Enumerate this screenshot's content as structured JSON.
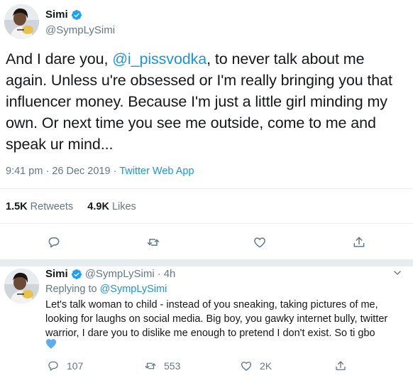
{
  "main_tweet": {
    "name": "Simi",
    "handle": "@SympLySimi",
    "text_before": "And I dare you, ",
    "mention": "@i_pissvodka",
    "text_after": ", to never talk about me again. Unless u're obsessed or I'm really bringing you that influencer money. Because I'm just a little girl minding my own. Or next time you see me outside, come to me and speak ur mind...",
    "time": "9:41 pm",
    "date": "26 Dec 2019",
    "separator": "·",
    "source": "Twitter Web App",
    "retweets_count": "1.5K",
    "retweets_label": "Retweets",
    "likes_count": "4.9K",
    "likes_label": "Likes"
  },
  "reply_tweet": {
    "name": "Simi",
    "handle": "@SympLySimi",
    "separator": "·",
    "age": "4h",
    "replying_label": "Replying to",
    "replying_to": "@SympLySimi",
    "text": "Let's talk woman to child - instead of you sneaking, taking pictures of me, looking for laughs on social media. Big boy, you gawky internet bully, twitter warrior, I dare you to dislike me enough to pretend I don't exist. So ti gbo",
    "emoji": "💙",
    "reply_count": "107",
    "retweet_count": "553",
    "like_count": "2K"
  },
  "colors": {
    "accent": "#1b95e0",
    "verified": "#1da1f2",
    "muted": "#657786",
    "divider": "#e6ecf0"
  },
  "icons": {
    "verified": "verified-badge-icon",
    "reply": "comment-bubble-icon",
    "retweet": "retweet-arrows-icon",
    "like": "heart-outline-icon",
    "share": "share-upload-icon",
    "more": "chevron-down-icon"
  }
}
